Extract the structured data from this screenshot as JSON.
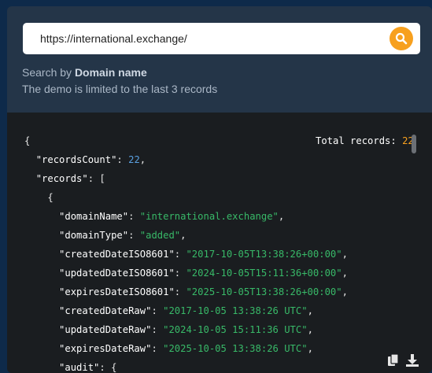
{
  "search": {
    "value": "https://international.exchange/",
    "hint_prefix": "Search by ",
    "hint_bold": "Domain name",
    "limit_note": "The demo is limited to the last 3 records"
  },
  "result": {
    "total_label": "Total records: ",
    "total_value": "22",
    "lines": [
      {
        "indent": 0,
        "tokens": [
          {
            "t": "p",
            "v": "{"
          }
        ]
      },
      {
        "indent": 1,
        "tokens": [
          {
            "t": "k",
            "v": "\"recordsCount\""
          },
          {
            "t": "p",
            "v": ": "
          },
          {
            "t": "n",
            "v": "22"
          },
          {
            "t": "p",
            "v": ","
          }
        ]
      },
      {
        "indent": 1,
        "tokens": [
          {
            "t": "k",
            "v": "\"records\""
          },
          {
            "t": "p",
            "v": ": ["
          }
        ]
      },
      {
        "indent": 2,
        "tokens": [
          {
            "t": "p",
            "v": "{"
          }
        ]
      },
      {
        "indent": 3,
        "tokens": [
          {
            "t": "k",
            "v": "\"domainName\""
          },
          {
            "t": "p",
            "v": ": "
          },
          {
            "t": "s",
            "v": "\"international.exchange\""
          },
          {
            "t": "p",
            "v": ","
          }
        ]
      },
      {
        "indent": 3,
        "tokens": [
          {
            "t": "k",
            "v": "\"domainType\""
          },
          {
            "t": "p",
            "v": ": "
          },
          {
            "t": "s",
            "v": "\"added\""
          },
          {
            "t": "p",
            "v": ","
          }
        ]
      },
      {
        "indent": 3,
        "tokens": [
          {
            "t": "k",
            "v": "\"createdDateISO8601\""
          },
          {
            "t": "p",
            "v": ": "
          },
          {
            "t": "s",
            "v": "\"2017-10-05T13:38:26+00:00\""
          },
          {
            "t": "p",
            "v": ","
          }
        ]
      },
      {
        "indent": 3,
        "tokens": [
          {
            "t": "k",
            "v": "\"updatedDateISO8601\""
          },
          {
            "t": "p",
            "v": ": "
          },
          {
            "t": "s",
            "v": "\"2024-10-05T15:11:36+00:00\""
          },
          {
            "t": "p",
            "v": ","
          }
        ]
      },
      {
        "indent": 3,
        "tokens": [
          {
            "t": "k",
            "v": "\"expiresDateISO8601\""
          },
          {
            "t": "p",
            "v": ": "
          },
          {
            "t": "s",
            "v": "\"2025-10-05T13:38:26+00:00\""
          },
          {
            "t": "p",
            "v": ","
          }
        ]
      },
      {
        "indent": 3,
        "tokens": [
          {
            "t": "k",
            "v": "\"createdDateRaw\""
          },
          {
            "t": "p",
            "v": ": "
          },
          {
            "t": "s",
            "v": "\"2017-10-05 13:38:26 UTC\""
          },
          {
            "t": "p",
            "v": ","
          }
        ]
      },
      {
        "indent": 3,
        "tokens": [
          {
            "t": "k",
            "v": "\"updatedDateRaw\""
          },
          {
            "t": "p",
            "v": ": "
          },
          {
            "t": "s",
            "v": "\"2024-10-05 15:11:36 UTC\""
          },
          {
            "t": "p",
            "v": ","
          }
        ]
      },
      {
        "indent": 3,
        "tokens": [
          {
            "t": "k",
            "v": "\"expiresDateRaw\""
          },
          {
            "t": "p",
            "v": ": "
          },
          {
            "t": "s",
            "v": "\"2025-10-05 13:38:26 UTC\""
          },
          {
            "t": "p",
            "v": ","
          }
        ]
      },
      {
        "indent": 3,
        "tokens": [
          {
            "t": "k",
            "v": "\"audit\""
          },
          {
            "t": "p",
            "v": ": {"
          }
        ]
      }
    ]
  },
  "icons": {
    "search": "search-icon",
    "copy": "copy-icon",
    "download": "download-icon"
  },
  "colors": {
    "accent": "#f7a01e",
    "json_string": "#38b968",
    "json_number": "#5aa0e0"
  }
}
